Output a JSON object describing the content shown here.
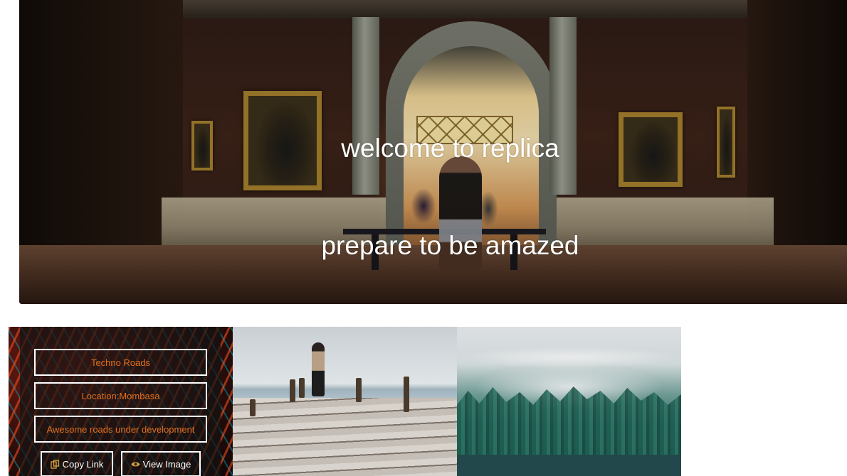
{
  "hero": {
    "line1": "welcome to replica",
    "line2": "prepare to be amazed"
  },
  "gallery": {
    "cards": [
      {
        "title": "Techno Roads",
        "location": "Location:Mombasa",
        "description": "Awesome roads under development",
        "copy_label": "Copy Link",
        "view_label": "View Image"
      }
    ]
  },
  "colors": {
    "accent_text": "#e0701f",
    "overlay": "rgba(20,20,20,0.72)",
    "button_border": "#ffffff"
  },
  "icons": {
    "copy": "copy-icon",
    "view": "eye-icon"
  }
}
